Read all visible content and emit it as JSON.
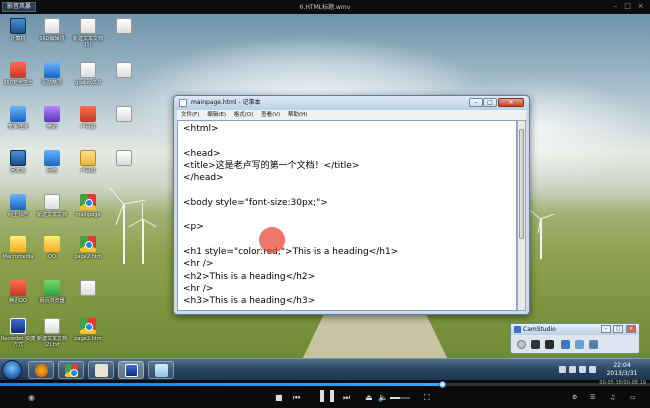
{
  "player": {
    "menu_label": "影音风暴",
    "title": "6.HTML标题.wmv",
    "time": "00:05:38/00:08:19",
    "progress_fraction": 0.68,
    "volume_fraction": 0.5
  },
  "desktop": {
    "icons": [
      {
        "label": "计算机",
        "icon": "computer-icon"
      },
      {
        "label": "SKD编辑说",
        "icon": "file-icon"
      },
      {
        "label": "新建文本文档 (1)",
        "icon": "file-icon"
      },
      {
        "label": "",
        "icon": "file-icon"
      },
      {
        "label": "360安全卫士",
        "icon": "security-icon"
      },
      {
        "label": "驱动精灵",
        "icon": "driver-icon"
      },
      {
        "label": "gsakev2.0",
        "icon": "file-icon"
      },
      {
        "label": "",
        "icon": "file-icon"
      },
      {
        "label": "宽带连接",
        "icon": "network-icon"
      },
      {
        "label": "腾讯",
        "icon": "app-icon"
      },
      {
        "label": "卢哥说",
        "icon": "archive-icon"
      },
      {
        "label": "",
        "icon": "file-icon"
      },
      {
        "label": "回收站",
        "icon": "recycle-bin-icon"
      },
      {
        "label": "网络",
        "icon": "network-icon"
      },
      {
        "label": "卢哥说",
        "icon": "folder-icon"
      },
      {
        "label": "",
        "icon": "file-icon"
      },
      {
        "label": "网上邻居",
        "icon": "network-icon"
      },
      {
        "label": "新建文本文档",
        "icon": "file-icon"
      },
      {
        "label": "mainpage",
        "icon": "chrome-icon"
      },
      {
        "label": "Macromedia",
        "icon": "app-icon"
      },
      {
        "label": "QQ",
        "icon": "qq-icon"
      },
      {
        "label": "page2.htm",
        "icon": "chrome-icon"
      },
      {
        "label": "腾讯QQ",
        "icon": "qq-icon"
      },
      {
        "label": "网页浏览器",
        "icon": "browser-icon"
      },
      {
        "label": "",
        "icon": "file-icon"
      },
      {
        "label": "Recorder 快捷方式",
        "icon": "recorder-icon"
      },
      {
        "label": "新建文本文档 (2).txt",
        "icon": "file-icon"
      },
      {
        "label": "page2.htm",
        "icon": "chrome-icon"
      }
    ]
  },
  "notepad": {
    "title": "mainpage.html - 记事本",
    "menu": [
      "文件(F)",
      "编辑(E)",
      "格式(O)",
      "查看(V)",
      "帮助(H)"
    ],
    "lines": [
      "<html>",
      "",
      "<head>",
      "<title>这是老卢写的第一个文档！</title>",
      "</head>",
      "",
      "<body style=\"font-size:30px;\">",
      "",
      "<p>",
      "",
      "<h1 style=\"color:red;\">This is a heading</h1>",
      "<hr />",
      "<h2>This is a heading</h2>",
      "<hr />",
      "<h3>This is a heading</h3>"
    ]
  },
  "camstudio": {
    "title": "CamStudio"
  },
  "taskbar": {
    "time": "22:04",
    "date": "2013/3/31"
  }
}
